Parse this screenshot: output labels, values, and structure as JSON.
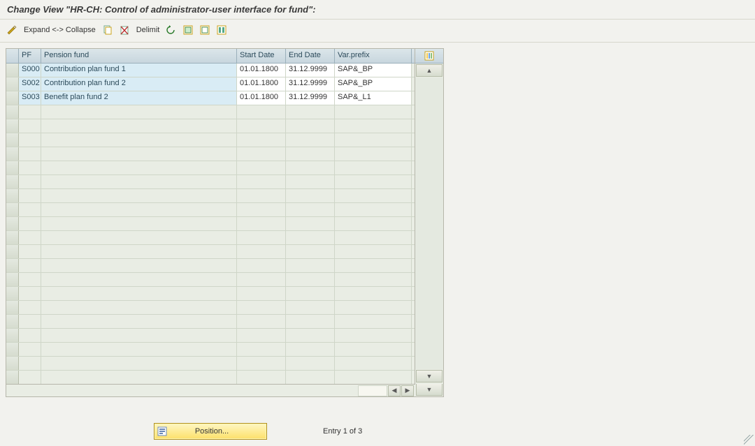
{
  "title": "Change View \"HR-CH: Control of administrator-user interface for fund\":",
  "toolbar": {
    "expand_collapse": "Expand <-> Collapse",
    "delimit": "Delimit"
  },
  "columns": {
    "pf": "PF",
    "fund": "Pension fund",
    "start": "Start Date",
    "end": "End Date",
    "varprefix": "Var.prefix"
  },
  "rows": [
    {
      "pf": "S000",
      "fund": "Contribution plan fund 1",
      "start": "01.01.1800",
      "end": "31.12.9999",
      "varprefix": "SAP&_BP"
    },
    {
      "pf": "S002",
      "fund": "Contribution plan fund 2",
      "start": "01.01.1800",
      "end": "31.12.9999",
      "varprefix": "SAP&_BP"
    },
    {
      "pf": "S003",
      "fund": "Benefit plan fund 2",
      "start": "01.01.1800",
      "end": "31.12.9999",
      "varprefix": "SAP&_L1"
    }
  ],
  "footer": {
    "position_label": "Position...",
    "entry_text": "Entry 1 of 3"
  }
}
